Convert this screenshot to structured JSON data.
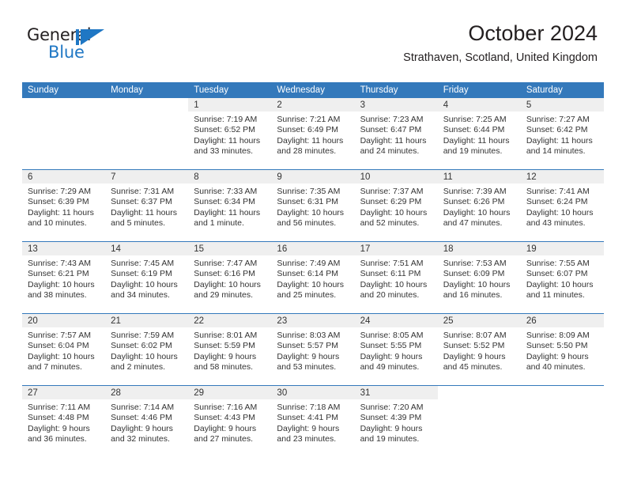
{
  "brand": {
    "line1": "General",
    "line2": "Blue",
    "accent_color": "#1f77c4",
    "triangle_icon": "brand-triangle-icon"
  },
  "header": {
    "title": "October 2024",
    "subtitle": "Strathaven, Scotland, United Kingdom"
  },
  "calendar": {
    "header_bg": "#3479bb",
    "daynum_bg": "#efefef",
    "weekday_headers": [
      "Sunday",
      "Monday",
      "Tuesday",
      "Wednesday",
      "Thursday",
      "Friday",
      "Saturday"
    ],
    "weeks": [
      [
        {
          "day": "",
          "blank": true,
          "sunrise": "",
          "sunset": "",
          "daylight1": "",
          "daylight2": ""
        },
        {
          "day": "",
          "blank": true,
          "sunrise": "",
          "sunset": "",
          "daylight1": "",
          "daylight2": ""
        },
        {
          "day": "1",
          "sunrise": "Sunrise: 7:19 AM",
          "sunset": "Sunset: 6:52 PM",
          "daylight1": "Daylight: 11 hours",
          "daylight2": "and 33 minutes."
        },
        {
          "day": "2",
          "sunrise": "Sunrise: 7:21 AM",
          "sunset": "Sunset: 6:49 PM",
          "daylight1": "Daylight: 11 hours",
          "daylight2": "and 28 minutes."
        },
        {
          "day": "3",
          "sunrise": "Sunrise: 7:23 AM",
          "sunset": "Sunset: 6:47 PM",
          "daylight1": "Daylight: 11 hours",
          "daylight2": "and 24 minutes."
        },
        {
          "day": "4",
          "sunrise": "Sunrise: 7:25 AM",
          "sunset": "Sunset: 6:44 PM",
          "daylight1": "Daylight: 11 hours",
          "daylight2": "and 19 minutes."
        },
        {
          "day": "5",
          "sunrise": "Sunrise: 7:27 AM",
          "sunset": "Sunset: 6:42 PM",
          "daylight1": "Daylight: 11 hours",
          "daylight2": "and 14 minutes."
        }
      ],
      [
        {
          "day": "6",
          "sunrise": "Sunrise: 7:29 AM",
          "sunset": "Sunset: 6:39 PM",
          "daylight1": "Daylight: 11 hours",
          "daylight2": "and 10 minutes."
        },
        {
          "day": "7",
          "sunrise": "Sunrise: 7:31 AM",
          "sunset": "Sunset: 6:37 PM",
          "daylight1": "Daylight: 11 hours",
          "daylight2": "and 5 minutes."
        },
        {
          "day": "8",
          "sunrise": "Sunrise: 7:33 AM",
          "sunset": "Sunset: 6:34 PM",
          "daylight1": "Daylight: 11 hours",
          "daylight2": "and 1 minute."
        },
        {
          "day": "9",
          "sunrise": "Sunrise: 7:35 AM",
          "sunset": "Sunset: 6:31 PM",
          "daylight1": "Daylight: 10 hours",
          "daylight2": "and 56 minutes."
        },
        {
          "day": "10",
          "sunrise": "Sunrise: 7:37 AM",
          "sunset": "Sunset: 6:29 PM",
          "daylight1": "Daylight: 10 hours",
          "daylight2": "and 52 minutes."
        },
        {
          "day": "11",
          "sunrise": "Sunrise: 7:39 AM",
          "sunset": "Sunset: 6:26 PM",
          "daylight1": "Daylight: 10 hours",
          "daylight2": "and 47 minutes."
        },
        {
          "day": "12",
          "sunrise": "Sunrise: 7:41 AM",
          "sunset": "Sunset: 6:24 PM",
          "daylight1": "Daylight: 10 hours",
          "daylight2": "and 43 minutes."
        }
      ],
      [
        {
          "day": "13",
          "sunrise": "Sunrise: 7:43 AM",
          "sunset": "Sunset: 6:21 PM",
          "daylight1": "Daylight: 10 hours",
          "daylight2": "and 38 minutes."
        },
        {
          "day": "14",
          "sunrise": "Sunrise: 7:45 AM",
          "sunset": "Sunset: 6:19 PM",
          "daylight1": "Daylight: 10 hours",
          "daylight2": "and 34 minutes."
        },
        {
          "day": "15",
          "sunrise": "Sunrise: 7:47 AM",
          "sunset": "Sunset: 6:16 PM",
          "daylight1": "Daylight: 10 hours",
          "daylight2": "and 29 minutes."
        },
        {
          "day": "16",
          "sunrise": "Sunrise: 7:49 AM",
          "sunset": "Sunset: 6:14 PM",
          "daylight1": "Daylight: 10 hours",
          "daylight2": "and 25 minutes."
        },
        {
          "day": "17",
          "sunrise": "Sunrise: 7:51 AM",
          "sunset": "Sunset: 6:11 PM",
          "daylight1": "Daylight: 10 hours",
          "daylight2": "and 20 minutes."
        },
        {
          "day": "18",
          "sunrise": "Sunrise: 7:53 AM",
          "sunset": "Sunset: 6:09 PM",
          "daylight1": "Daylight: 10 hours",
          "daylight2": "and 16 minutes."
        },
        {
          "day": "19",
          "sunrise": "Sunrise: 7:55 AM",
          "sunset": "Sunset: 6:07 PM",
          "daylight1": "Daylight: 10 hours",
          "daylight2": "and 11 minutes."
        }
      ],
      [
        {
          "day": "20",
          "sunrise": "Sunrise: 7:57 AM",
          "sunset": "Sunset: 6:04 PM",
          "daylight1": "Daylight: 10 hours",
          "daylight2": "and 7 minutes."
        },
        {
          "day": "21",
          "sunrise": "Sunrise: 7:59 AM",
          "sunset": "Sunset: 6:02 PM",
          "daylight1": "Daylight: 10 hours",
          "daylight2": "and 2 minutes."
        },
        {
          "day": "22",
          "sunrise": "Sunrise: 8:01 AM",
          "sunset": "Sunset: 5:59 PM",
          "daylight1": "Daylight: 9 hours",
          "daylight2": "and 58 minutes."
        },
        {
          "day": "23",
          "sunrise": "Sunrise: 8:03 AM",
          "sunset": "Sunset: 5:57 PM",
          "daylight1": "Daylight: 9 hours",
          "daylight2": "and 53 minutes."
        },
        {
          "day": "24",
          "sunrise": "Sunrise: 8:05 AM",
          "sunset": "Sunset: 5:55 PM",
          "daylight1": "Daylight: 9 hours",
          "daylight2": "and 49 minutes."
        },
        {
          "day": "25",
          "sunrise": "Sunrise: 8:07 AM",
          "sunset": "Sunset: 5:52 PM",
          "daylight1": "Daylight: 9 hours",
          "daylight2": "and 45 minutes."
        },
        {
          "day": "26",
          "sunrise": "Sunrise: 8:09 AM",
          "sunset": "Sunset: 5:50 PM",
          "daylight1": "Daylight: 9 hours",
          "daylight2": "and 40 minutes."
        }
      ],
      [
        {
          "day": "27",
          "sunrise": "Sunrise: 7:11 AM",
          "sunset": "Sunset: 4:48 PM",
          "daylight1": "Daylight: 9 hours",
          "daylight2": "and 36 minutes."
        },
        {
          "day": "28",
          "sunrise": "Sunrise: 7:14 AM",
          "sunset": "Sunset: 4:46 PM",
          "daylight1": "Daylight: 9 hours",
          "daylight2": "and 32 minutes."
        },
        {
          "day": "29",
          "sunrise": "Sunrise: 7:16 AM",
          "sunset": "Sunset: 4:43 PM",
          "daylight1": "Daylight: 9 hours",
          "daylight2": "and 27 minutes."
        },
        {
          "day": "30",
          "sunrise": "Sunrise: 7:18 AM",
          "sunset": "Sunset: 4:41 PM",
          "daylight1": "Daylight: 9 hours",
          "daylight2": "and 23 minutes."
        },
        {
          "day": "31",
          "sunrise": "Sunrise: 7:20 AM",
          "sunset": "Sunset: 4:39 PM",
          "daylight1": "Daylight: 9 hours",
          "daylight2": "and 19 minutes."
        },
        {
          "day": "",
          "blank": true,
          "sunrise": "",
          "sunset": "",
          "daylight1": "",
          "daylight2": ""
        },
        {
          "day": "",
          "blank": true,
          "sunrise": "",
          "sunset": "",
          "daylight1": "",
          "daylight2": ""
        }
      ]
    ]
  }
}
